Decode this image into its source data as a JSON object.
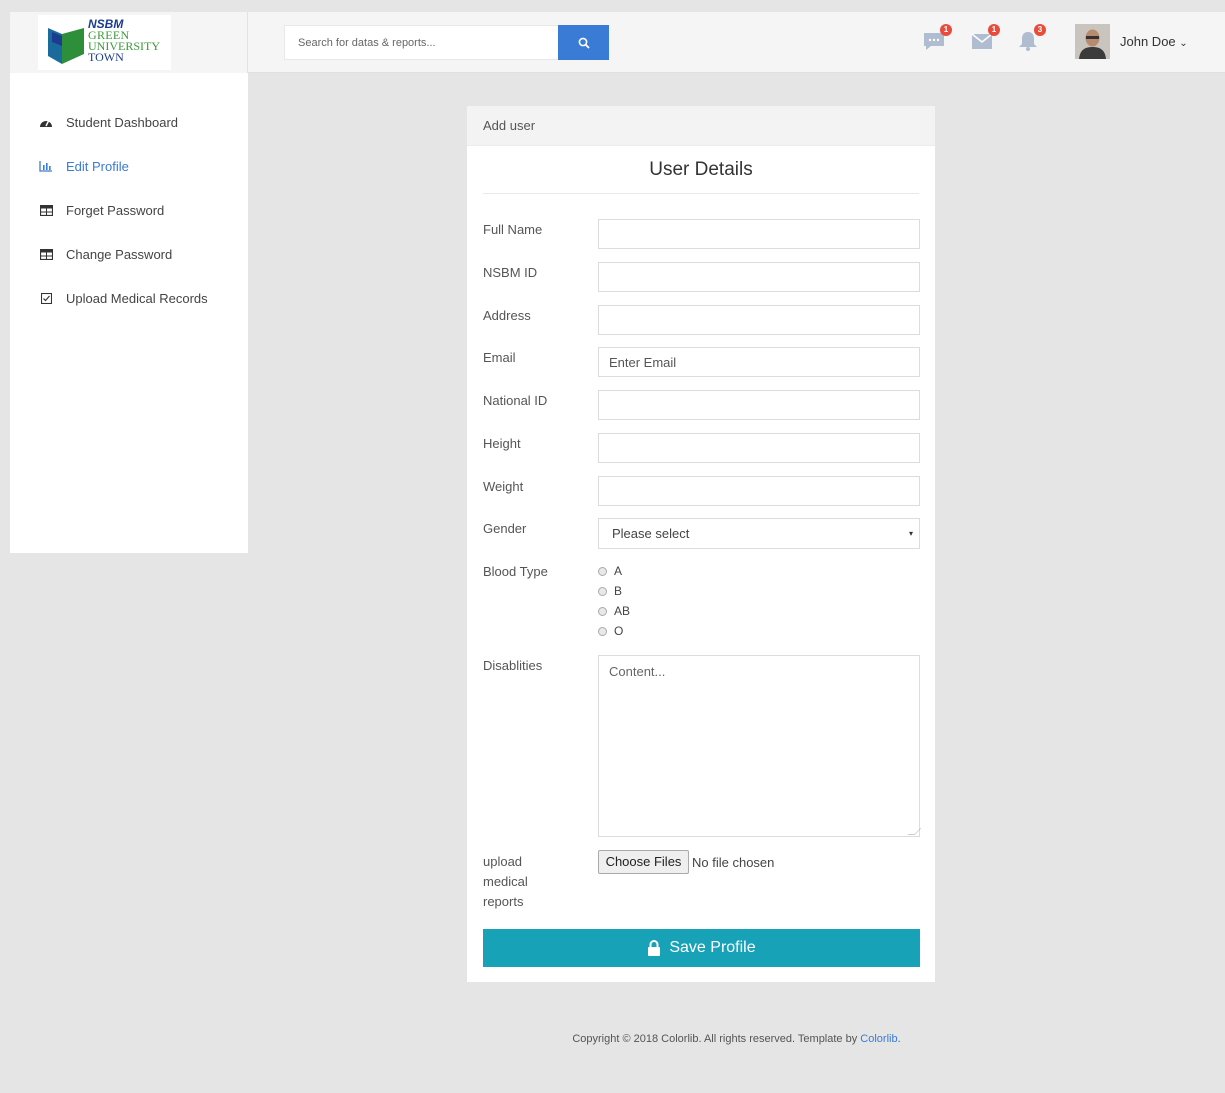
{
  "header": {
    "logo": {
      "nsbm": "NSBM",
      "green": "GREEN",
      "university": "UNIVERSITY",
      "town": "TOWN"
    },
    "search": {
      "placeholder": "Search for datas & reports..."
    },
    "icons": [
      {
        "name": "chat-icon",
        "badge": "1"
      },
      {
        "name": "mail-icon",
        "badge": "1"
      },
      {
        "name": "bell-icon",
        "badge": "3"
      }
    ],
    "user": {
      "name": "John Doe",
      "caret": "⌄"
    }
  },
  "sidebar": {
    "items": [
      {
        "label": "Student Dashboard",
        "icon": "dashboard-icon"
      },
      {
        "label": "Edit Profile",
        "icon": "bar-chart-icon",
        "active": true
      },
      {
        "label": "Forget Password",
        "icon": "table-icon"
      },
      {
        "label": "Change Password",
        "icon": "table-icon"
      },
      {
        "label": "Upload Medical Records",
        "icon": "checkbox-icon"
      }
    ]
  },
  "card": {
    "header": "Add user",
    "title": "User Details",
    "fields": {
      "full_name": {
        "label": "Full Name",
        "value": ""
      },
      "nsbm_id": {
        "label": "NSBM ID",
        "value": ""
      },
      "address": {
        "label": "Address",
        "value": ""
      },
      "email": {
        "label": "Email",
        "placeholder": "Enter Email"
      },
      "national_id": {
        "label": "National ID",
        "value": ""
      },
      "height": {
        "label": "Height",
        "value": ""
      },
      "weight": {
        "label": "Weight",
        "value": ""
      },
      "gender": {
        "label": "Gender",
        "selected": "Please select",
        "caret": "▾"
      },
      "blood_type": {
        "label": "Blood Type",
        "options": [
          "A",
          "B",
          "AB",
          "O"
        ]
      },
      "disabilities": {
        "label": "Disablities",
        "placeholder": "Content..."
      },
      "upload": {
        "label_line1": "upload",
        "label_line2": "medical",
        "label_line3": "reports",
        "button": "Choose Files",
        "status": "No file chosen"
      }
    },
    "save_label": "Save Profile"
  },
  "footer": {
    "text": "Copyright © 2018 Colorlib. All rights reserved. Template by ",
    "link": "Colorlib",
    "end": "."
  },
  "colors": {
    "primary": "#3a7bd5",
    "save": "#17a2b8",
    "badge": "#e74c3c"
  }
}
